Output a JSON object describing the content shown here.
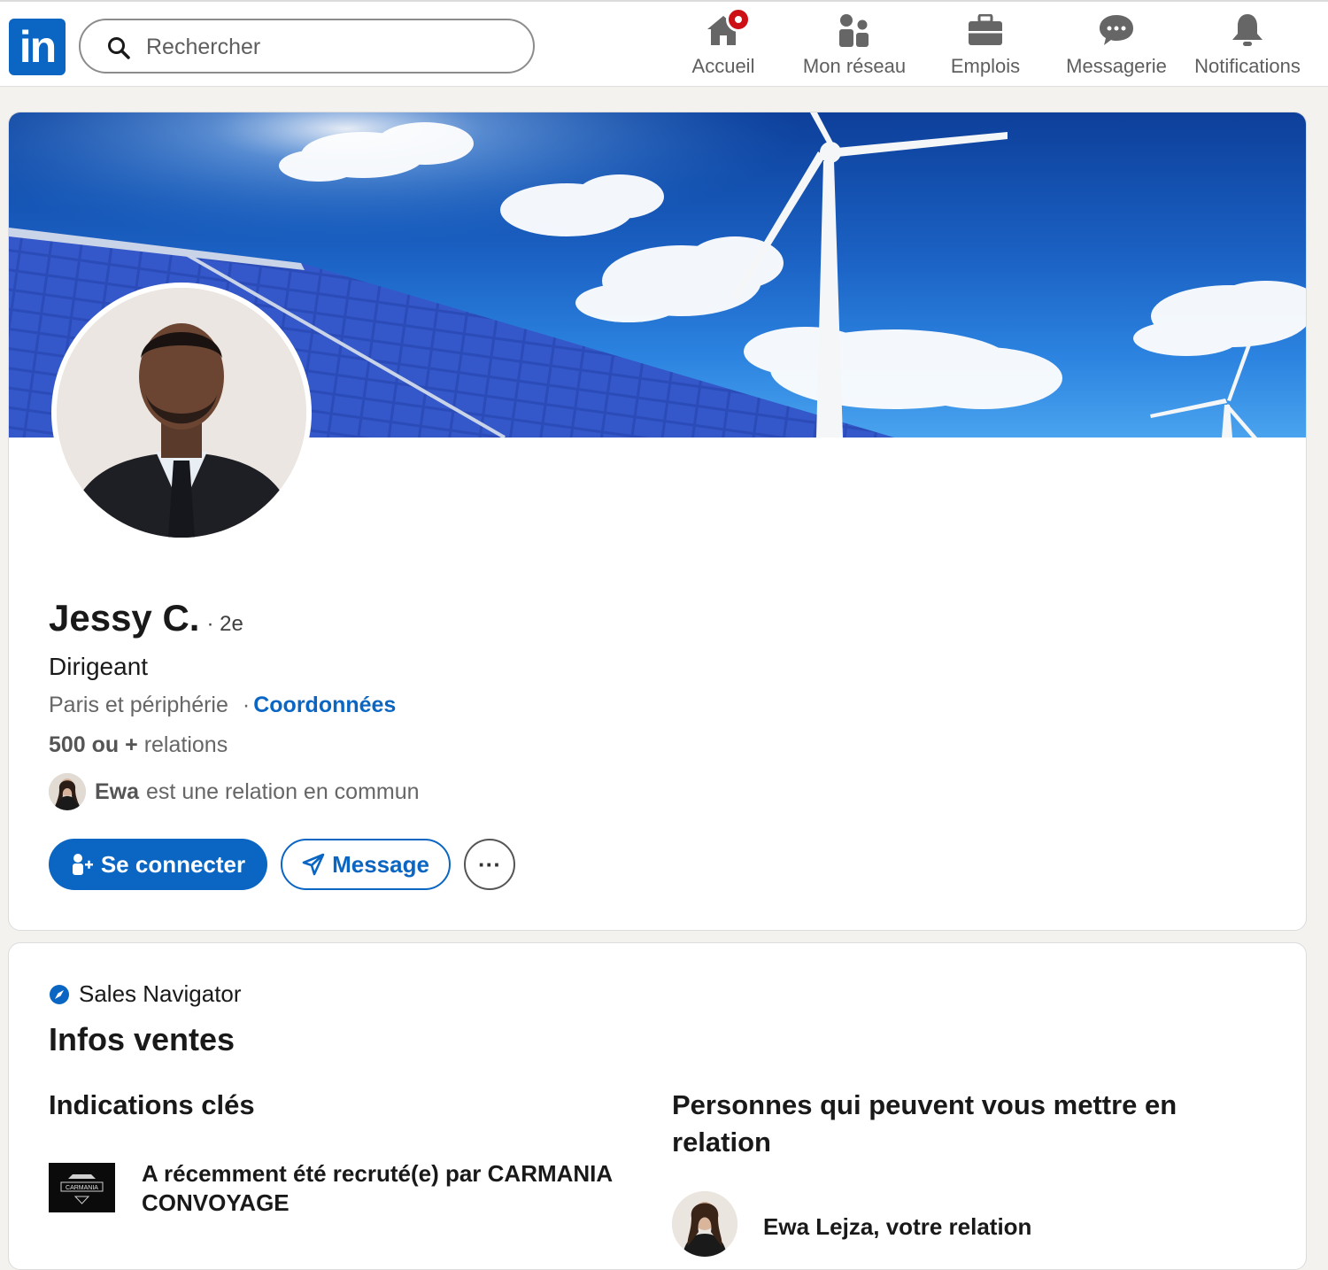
{
  "nav": {
    "search_placeholder": "Rechercher",
    "items": [
      {
        "label": "Accueil",
        "icon": "home-icon",
        "notification": true
      },
      {
        "label": "Mon réseau",
        "icon": "network-icon"
      },
      {
        "label": "Emplois",
        "icon": "briefcase-icon"
      },
      {
        "label": "Messagerie",
        "icon": "chat-icon"
      },
      {
        "label": "Notifications",
        "icon": "bell-icon"
      }
    ]
  },
  "profile": {
    "name": "Jessy C.",
    "degree": "· 2e",
    "headline": "Dirigeant",
    "location": "Paris et périphérie",
    "location_sep": "·",
    "contact_link": "Coordonnées",
    "relations_count": "500 ou +",
    "relations_label": "relations",
    "mutual_name": "Ewa",
    "mutual_text": "est une relation en commun",
    "actions": {
      "connect": "Se connecter",
      "message": "Message",
      "more": "···"
    }
  },
  "sales": {
    "brand": "Sales Navigator",
    "title": "Infos ventes",
    "key_title": "Indications clés",
    "key_item": "A récemment été recruté(e) par CARMANIA CONVOYAGE",
    "people_title": "Personnes qui peuvent vous mettre en relation",
    "person": "Ewa Lejza, votre relation",
    "logo_text": "CARMANIA"
  },
  "colors": {
    "brand_blue": "#0a66c2",
    "notification_red": "#cc1016",
    "page_bg": "#f3f2ef"
  }
}
